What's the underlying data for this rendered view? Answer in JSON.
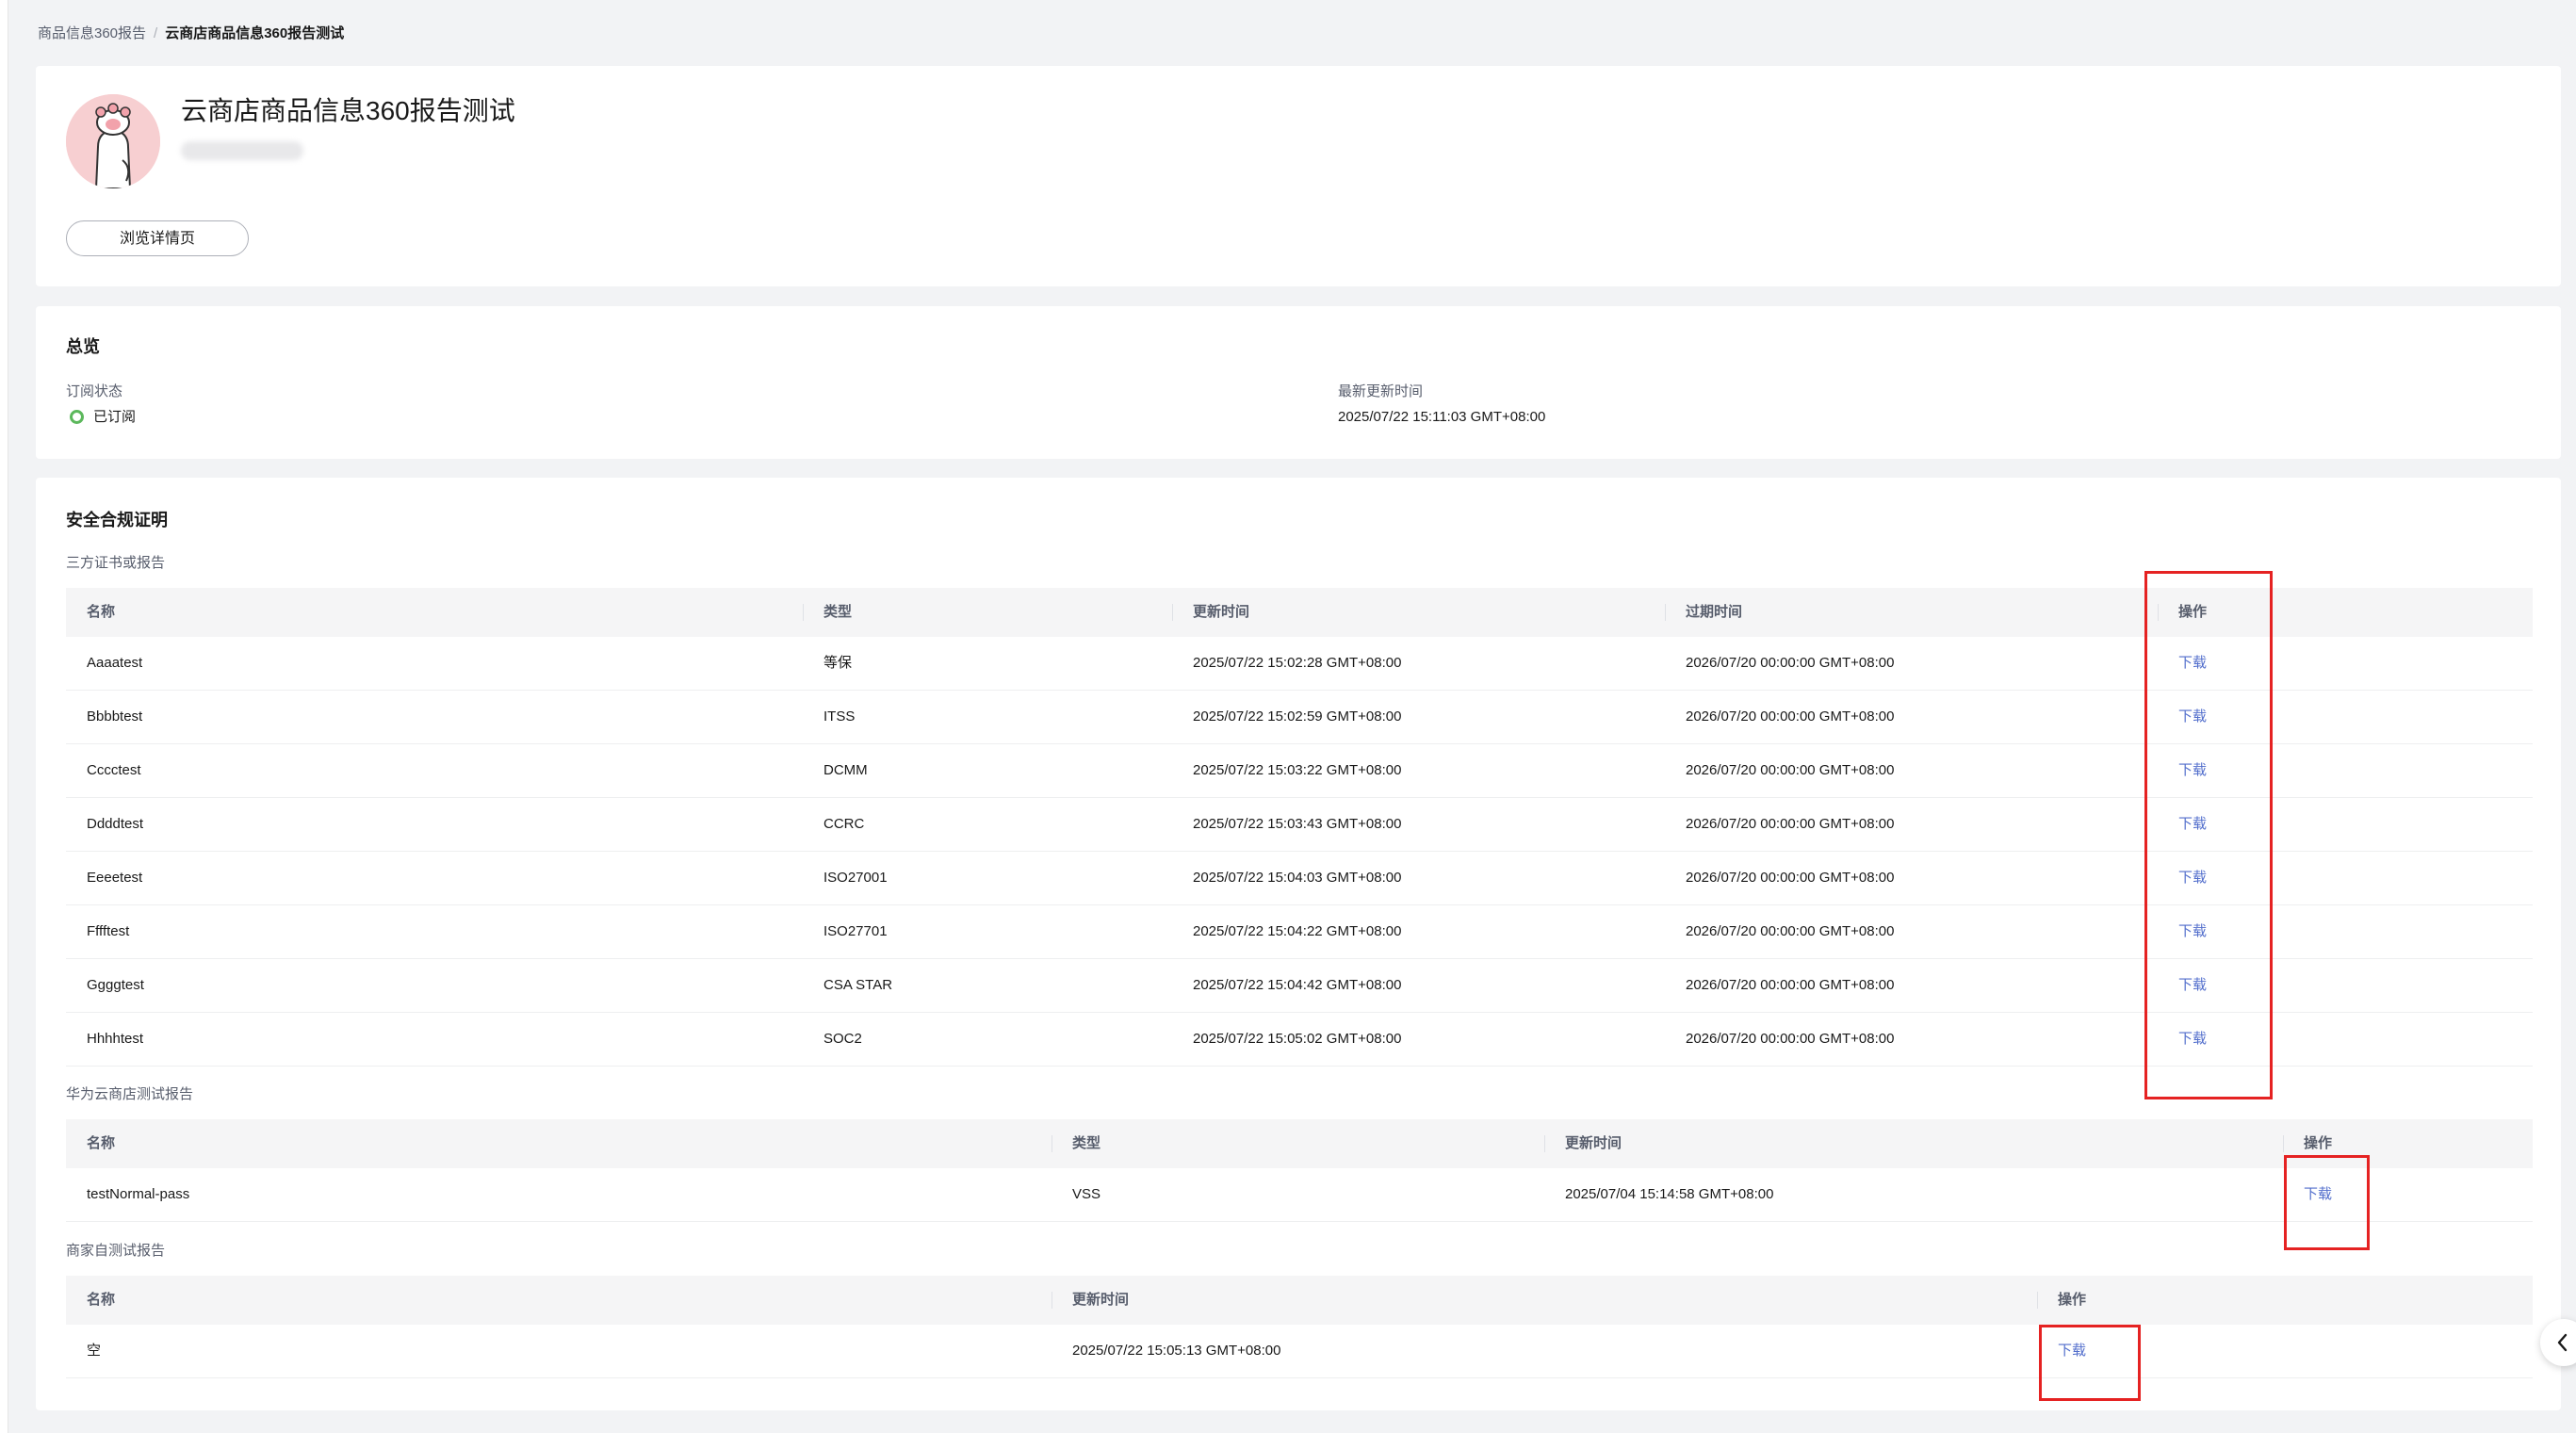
{
  "breadcrumb": {
    "parent": "商品信息360报告",
    "separator": "/",
    "current": "云商店商品信息360报告测试"
  },
  "header": {
    "title": "云商店商品信息360报告测试",
    "view_detail_button": "浏览详情页",
    "avatar_icon": "paw-avatar-icon"
  },
  "overview": {
    "title": "总览",
    "subscription_label": "订阅状态",
    "subscription_value": "已订阅",
    "updated_label": "最新更新时间",
    "updated_value": "2025/07/22 15:11:03 GMT+08:00",
    "status_color": "#5cb85c"
  },
  "security": {
    "title": "安全合规证明",
    "third_party": {
      "title": "三方证书或报告",
      "headers": [
        "名称",
        "类型",
        "更新时间",
        "过期时间",
        "操作"
      ],
      "rows": [
        [
          "Aaaatest",
          "等保",
          "2025/07/22 15:02:28 GMT+08:00",
          "2026/07/20 00:00:00 GMT+08:00",
          "下载"
        ],
        [
          "Bbbbtest",
          "ITSS",
          "2025/07/22 15:02:59 GMT+08:00",
          "2026/07/20 00:00:00 GMT+08:00",
          "下载"
        ],
        [
          "Cccctest",
          "DCMM",
          "2025/07/22 15:03:22 GMT+08:00",
          "2026/07/20 00:00:00 GMT+08:00",
          "下载"
        ],
        [
          "Ddddtest",
          "CCRC",
          "2025/07/22 15:03:43 GMT+08:00",
          "2026/07/20 00:00:00 GMT+08:00",
          "下载"
        ],
        [
          "Eeeetest",
          "ISO27001",
          "2025/07/22 15:04:03 GMT+08:00",
          "2026/07/20 00:00:00 GMT+08:00",
          "下载"
        ],
        [
          "Fffftest",
          "ISO27701",
          "2025/07/22 15:04:22 GMT+08:00",
          "2026/07/20 00:00:00 GMT+08:00",
          "下载"
        ],
        [
          "Ggggtest",
          "CSA STAR",
          "2025/07/22 15:04:42 GMT+08:00",
          "2026/07/20 00:00:00 GMT+08:00",
          "下载"
        ],
        [
          "Hhhhtest",
          "SOC2",
          "2025/07/22 15:05:02 GMT+08:00",
          "2026/07/20 00:00:00 GMT+08:00",
          "下载"
        ]
      ]
    },
    "huawei": {
      "title": "华为云商店测试报告",
      "headers": [
        "名称",
        "类型",
        "更新时间",
        "操作"
      ],
      "rows": [
        [
          "testNormal-pass",
          "VSS",
          "2025/07/04 15:14:58 GMT+08:00",
          "下载"
        ]
      ]
    },
    "merchant": {
      "title": "商家自测试报告",
      "headers": [
        "名称",
        "更新时间",
        "操作"
      ],
      "rows": [
        [
          "空",
          "2025/07/22 15:05:13 GMT+08:00",
          "下载"
        ]
      ]
    },
    "link_color": "#526ecc",
    "highlight_color": "#e52222"
  },
  "side": {
    "collapse_icon": "chevron-left-icon"
  }
}
